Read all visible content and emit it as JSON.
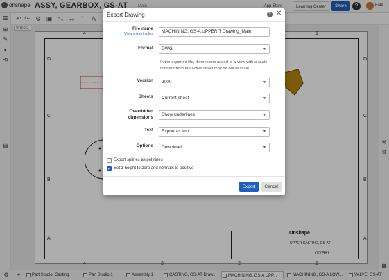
{
  "app": {
    "logo_text": "onshape",
    "document_title": "ASSY, GEARBOX, GS-AT",
    "document_subtitle": "Main",
    "app_store_label": "App Store",
    "learning_center_label": "Learning Center",
    "share_label": "Share",
    "user_name": "Falk"
  },
  "sheet": {
    "tab_label": "Sheet1",
    "grid_numbers": [
      "4",
      "3",
      "2",
      "1"
    ],
    "grid_letters": [
      "D",
      "C",
      "B",
      "A"
    ],
    "title_block": {
      "company": "Onshape",
      "part_name": "UPPER CASTING, GS-AT",
      "part_number": "000581"
    }
  },
  "dialog": {
    "title": "Export Drawing",
    "file_name_label": "File name",
    "export_rules_link": "View export rules",
    "file_name_value": "MACHINING, GS-A UPPER T Drawing_Main",
    "format_label": "Format",
    "format_value": "DWG",
    "format_note": "In the exported file, dimensions added to a view with a scale different from the active sheet may be out of scale.",
    "version_label": "Version",
    "version_value": "2000",
    "sheets_label": "Sheets",
    "sheets_value": "Current sheet",
    "overridden_label_1": "Overridden",
    "overridden_label_2": "dimensions",
    "overridden_value": "Show underlines",
    "text_label": "Text",
    "text_value": "Export as text",
    "options_label": "Options",
    "options_value": "Download",
    "splines_label": "Export splines as polylines",
    "splines_checked": false,
    "zheight_label": "Set z-height to zero and normals to positive",
    "zheight_checked": true,
    "export_label": "Export",
    "cancel_label": "Cancel"
  },
  "bottom_tabs": [
    "Part Studio, Casting",
    "Part Studio 1",
    "Assembly 1",
    "CASTING, GS-AT Draw...",
    "MACHINING, GS-A UPP...",
    "MACHINING, GS-A LOW...",
    "VALVE, GS-AT"
  ],
  "colors": {
    "accent": "#1f5fbf",
    "overlay": "rgba(0,0,0,0.32)"
  }
}
